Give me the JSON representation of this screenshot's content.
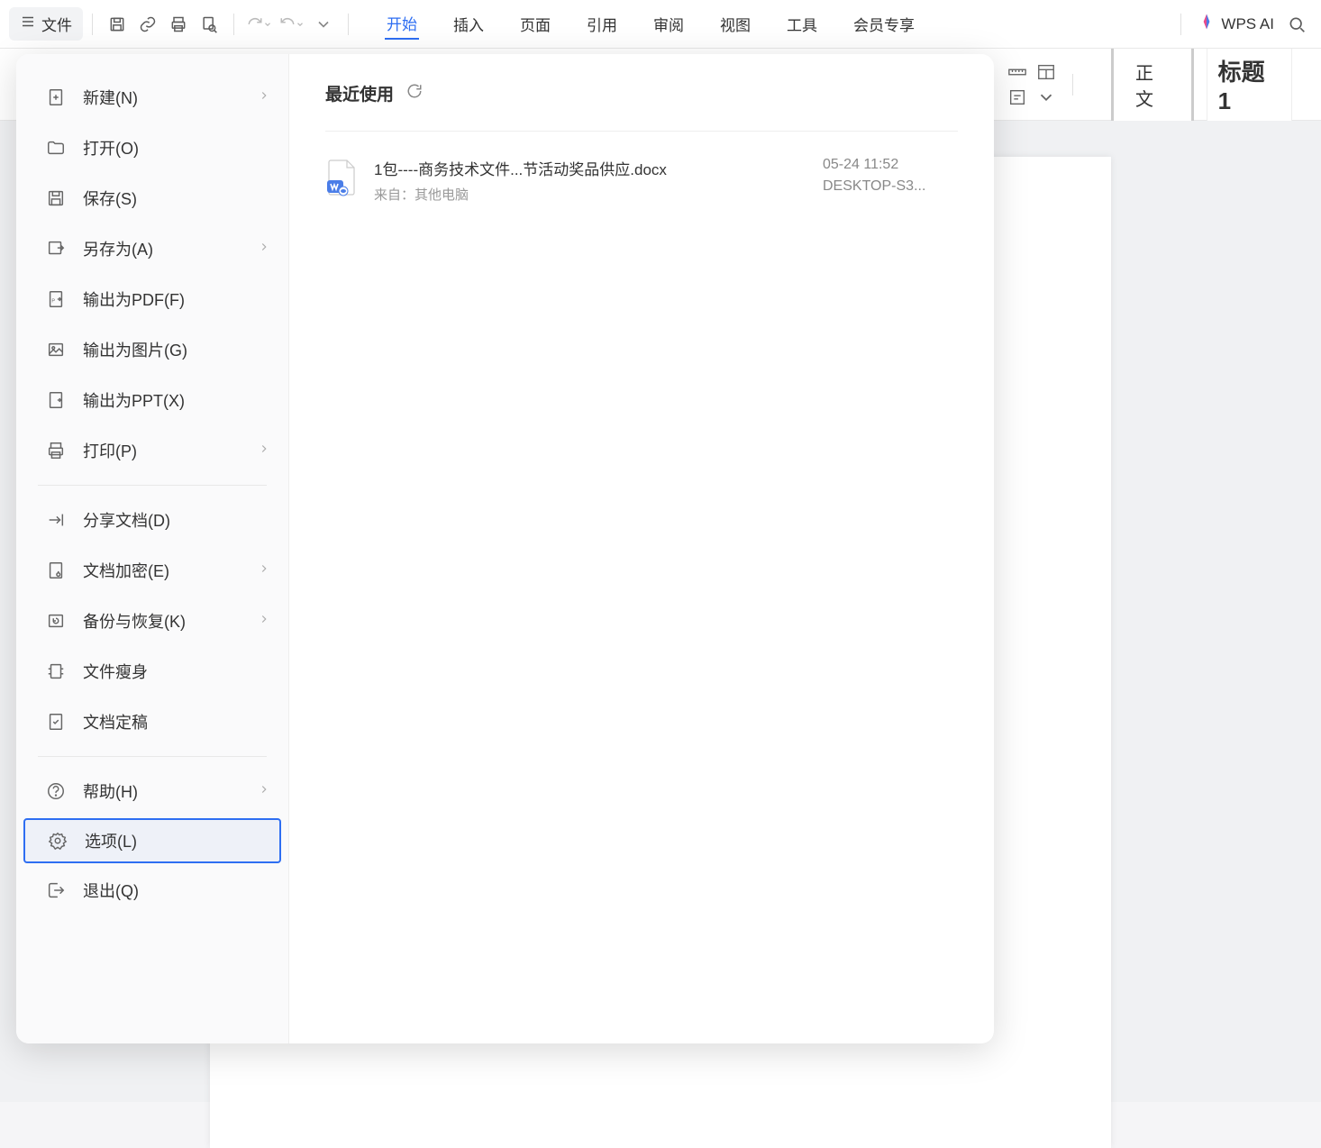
{
  "toolbar": {
    "file_label": "文件",
    "wps_ai_label": "WPS AI"
  },
  "ribbon": {
    "tabs": [
      "开始",
      "插入",
      "页面",
      "引用",
      "审阅",
      "视图",
      "工具",
      "会员专享"
    ],
    "active_index": 0
  },
  "styles": {
    "normal": "正文",
    "heading1": "标题  1"
  },
  "file_menu": {
    "items": [
      {
        "label": "新建(N)",
        "icon": "new",
        "has_submenu": true
      },
      {
        "label": "打开(O)",
        "icon": "open",
        "has_submenu": false
      },
      {
        "label": "保存(S)",
        "icon": "save",
        "has_submenu": false
      },
      {
        "label": "另存为(A)",
        "icon": "saveas",
        "has_submenu": true
      },
      {
        "label": "输出为PDF(F)",
        "icon": "pdf",
        "has_submenu": false
      },
      {
        "label": "输出为图片(G)",
        "icon": "image",
        "has_submenu": false
      },
      {
        "label": "输出为PPT(X)",
        "icon": "ppt",
        "has_submenu": false
      },
      {
        "label": "打印(P)",
        "icon": "print",
        "has_submenu": true
      },
      {
        "divider": true
      },
      {
        "label": "分享文档(D)",
        "icon": "share",
        "has_submenu": false
      },
      {
        "label": "文档加密(E)",
        "icon": "encrypt",
        "has_submenu": true
      },
      {
        "label": "备份与恢复(K)",
        "icon": "backup",
        "has_submenu": true
      },
      {
        "label": "文件瘦身",
        "icon": "slim",
        "has_submenu": false
      },
      {
        "label": "文档定稿",
        "icon": "finalize",
        "has_submenu": false
      },
      {
        "divider": true
      },
      {
        "label": "帮助(H)",
        "icon": "help",
        "has_submenu": true
      },
      {
        "label": "选项(L)",
        "icon": "options",
        "has_submenu": false,
        "selected": true
      },
      {
        "label": "退出(Q)",
        "icon": "exit",
        "has_submenu": false
      }
    ],
    "recent_title": "最近使用",
    "recent_files": [
      {
        "name": "1包----商务技术文件...节活动奖品供应.docx",
        "source": "来自：其他电脑",
        "date": "05-24 11:52",
        "device": "DESKTOP-S3..."
      }
    ]
  }
}
